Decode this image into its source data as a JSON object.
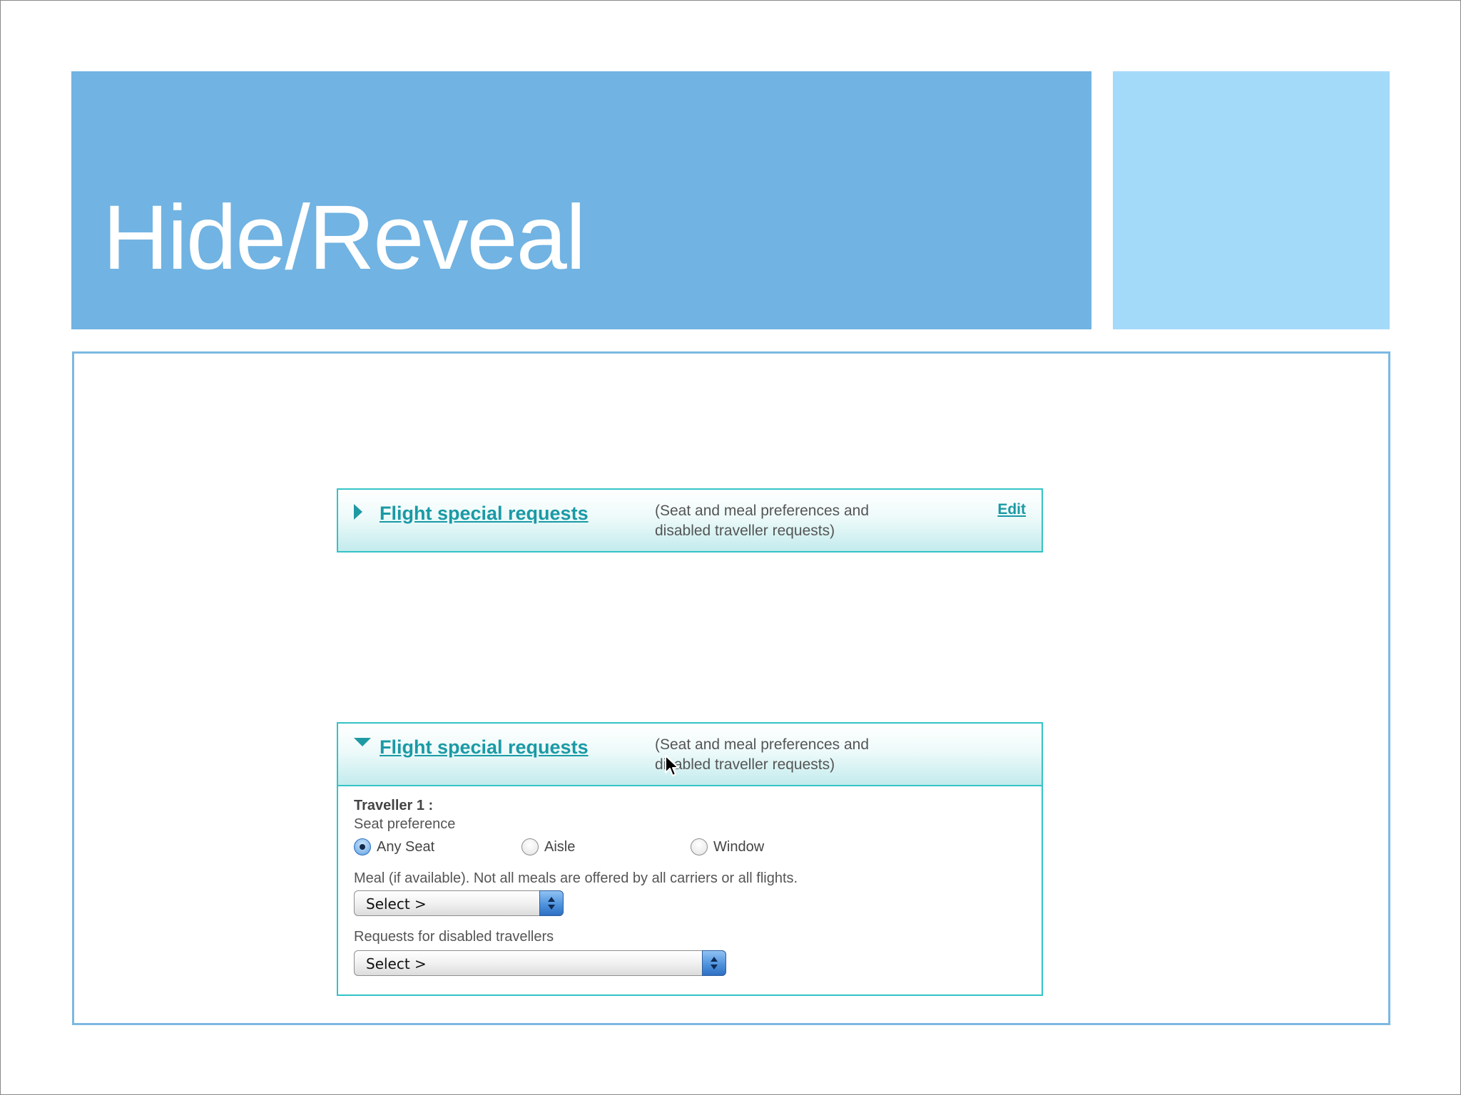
{
  "slide": {
    "title": "Hide/Reveal"
  },
  "collapsed_panel": {
    "title": "Flight special requests",
    "description": "(Seat and meal preferences and disabled traveller requests)",
    "edit_label": "Edit"
  },
  "expanded_panel": {
    "title": "Flight special requests",
    "description": "(Seat and meal preferences and disabled traveller requests)",
    "traveller_label": "Traveller 1 :",
    "seat_label": "Seat preference",
    "seat_options": [
      {
        "label": "Any Seat",
        "checked": true
      },
      {
        "label": "Aisle",
        "checked": false
      },
      {
        "label": "Window",
        "checked": false
      }
    ],
    "meal_label": "Meal (if available). Not all meals are offered by all carriers or all flights.",
    "meal_select_value": "Select >",
    "disabled_label": "Requests for disabled travellers",
    "disabled_select_value": "Select >"
  },
  "colors": {
    "title_bar": "#71b3e2",
    "accent_block": "#a3daf9",
    "panel_border": "#33c3c6",
    "link": "#1a9aa5"
  },
  "icons": {
    "collapsed_indicator": "triangle-right-icon",
    "expanded_indicator": "triangle-down-icon",
    "select_arrows": "updown-arrows-icon",
    "pointer": "mouse-cursor-icon"
  }
}
